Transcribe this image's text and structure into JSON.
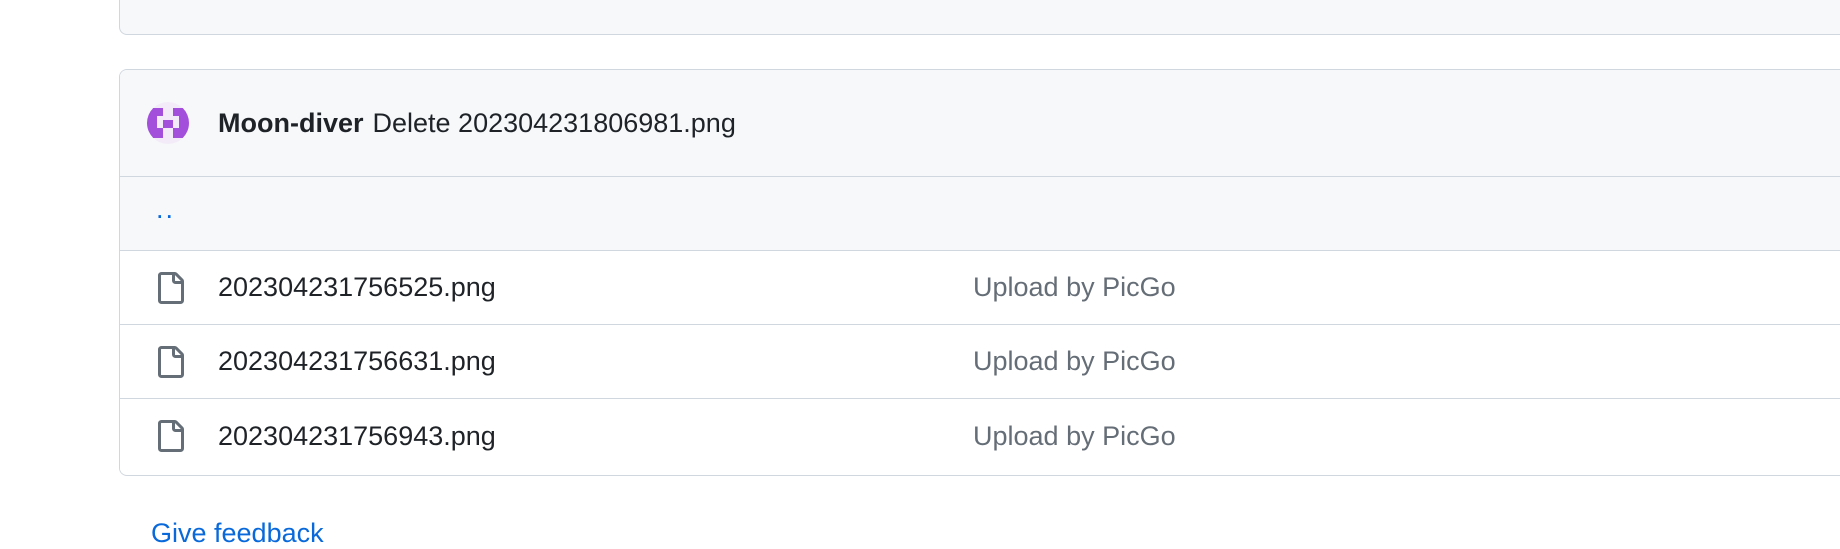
{
  "latest_commit": {
    "author": "Moon-diver",
    "message": "Delete 202304231806981.png",
    "avatar_colors": {
      "background": "#f3ecf8",
      "foreground": "#a34fdb"
    }
  },
  "parent_dir_label": "..",
  "files": [
    {
      "name": "202304231756525.png",
      "commit_message": "Upload by PicGo",
      "icon": "file-icon"
    },
    {
      "name": "202304231756631.png",
      "commit_message": "Upload by PicGo",
      "icon": "file-icon"
    },
    {
      "name": "202304231756943.png",
      "commit_message": "Upload by PicGo",
      "icon": "file-icon"
    }
  ],
  "footer_link": "Give feedback",
  "colors": {
    "link": "#0969da",
    "muted": "#656d76",
    "border": "#d0d7de",
    "header_bg": "#f6f8fa"
  }
}
